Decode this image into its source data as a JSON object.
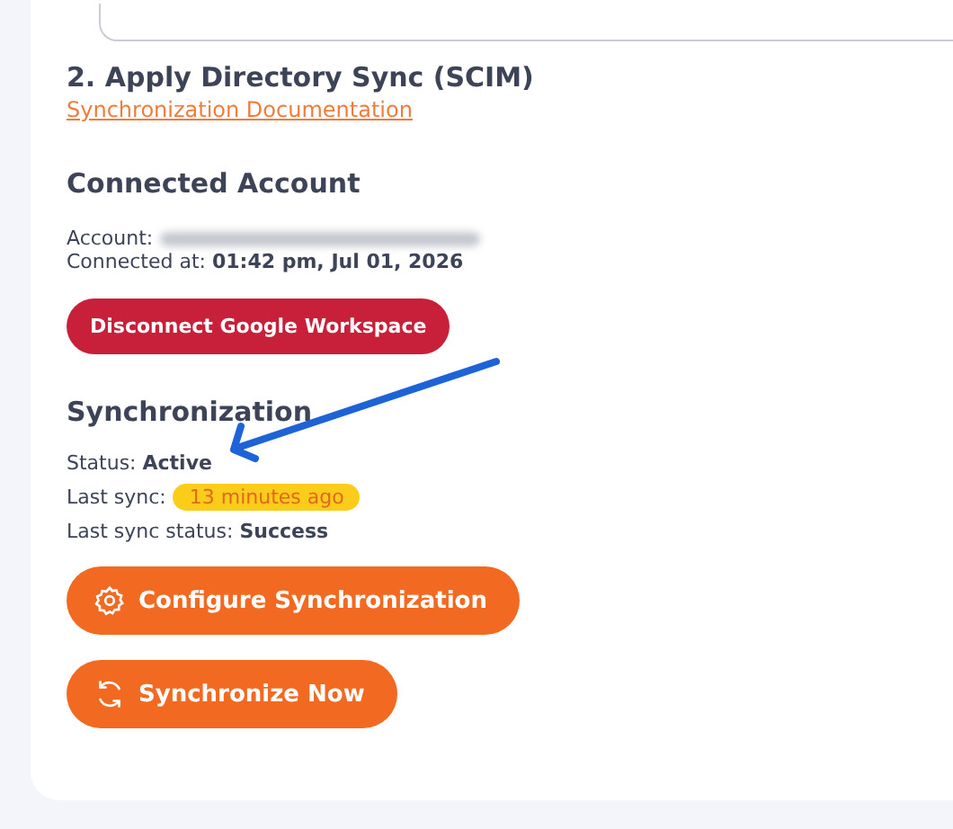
{
  "section": {
    "title": "2. Apply Directory Sync (SCIM)",
    "link": "Synchronization Documentation"
  },
  "connected_account": {
    "heading": "Connected Account",
    "account_label": "Account:",
    "connected_label": "Connected at:",
    "connected_value": "01:42 pm, Jul 01, 2026",
    "button": "Disconnect Google Workspace"
  },
  "synchronization": {
    "heading": "Synchronization",
    "rows": [
      {
        "kind": "bold",
        "label": "Status:",
        "value": "Active"
      },
      {
        "kind": "badge",
        "label": "Last sync:",
        "value": "13 minutes ago"
      },
      {
        "kind": "bold",
        "label": "Last sync status:",
        "value": "Success"
      }
    ],
    "buttons": [
      {
        "kind": "configure",
        "label": "Configure Synchronization"
      },
      {
        "kind": "sync",
        "label": "Synchronize Now"
      }
    ]
  }
}
